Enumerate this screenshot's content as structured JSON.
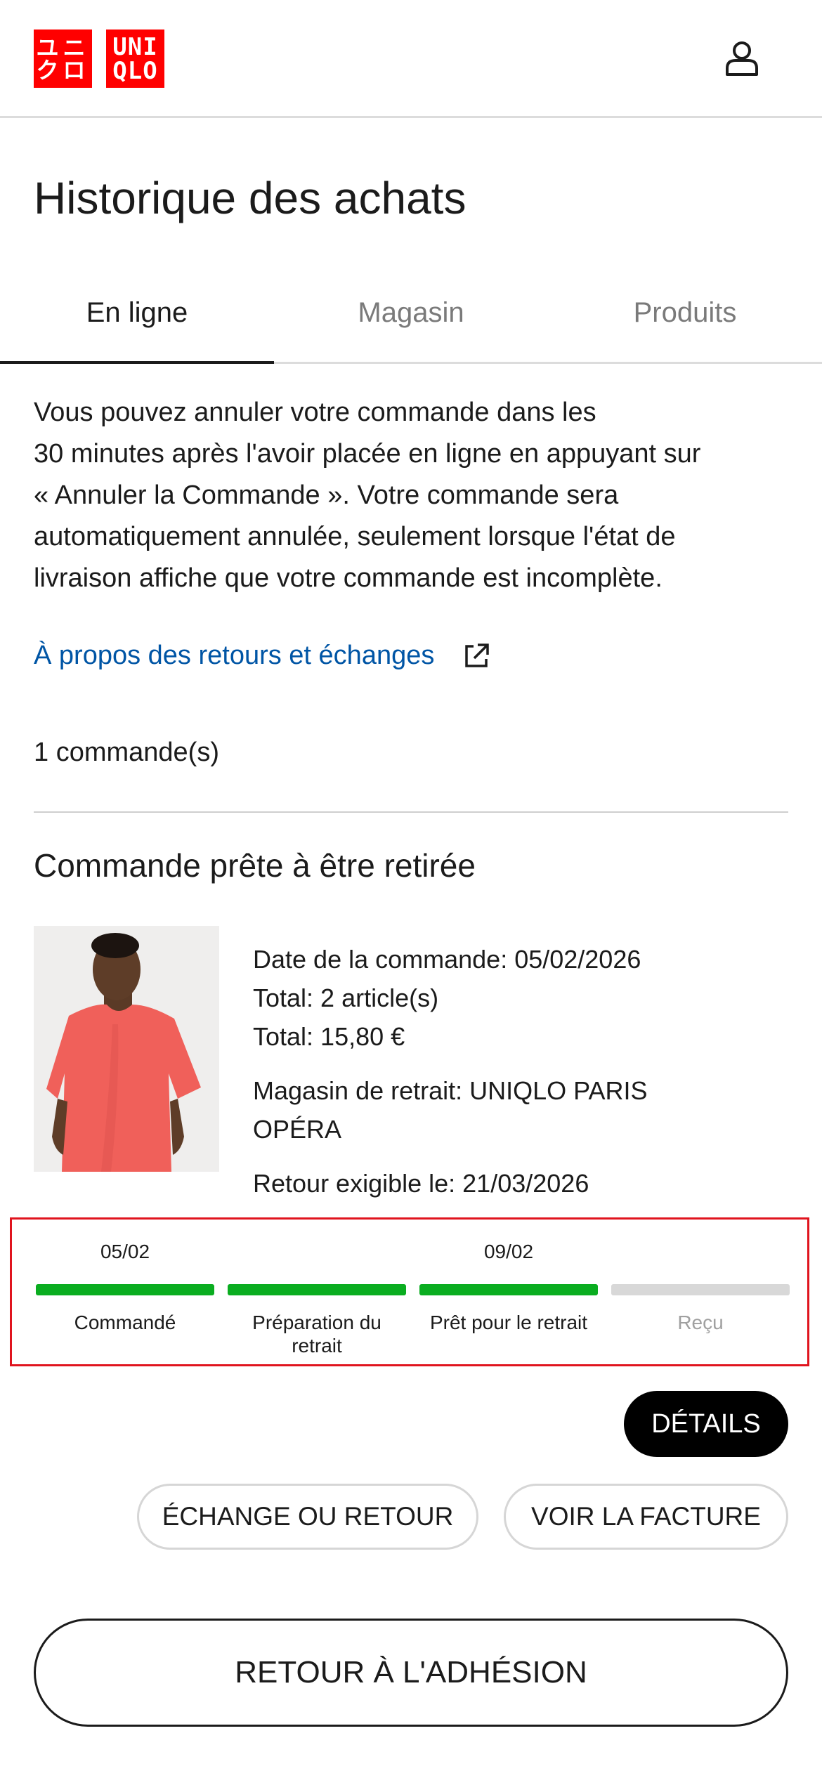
{
  "header": {
    "logo_jp_top": "ユニ",
    "logo_jp_bottom": "クロ",
    "logo_en_top": "UNI",
    "logo_en_bottom": "QLO",
    "account_icon": "user-icon"
  },
  "page": {
    "title": "Historique des achats"
  },
  "tabs": [
    {
      "label": "En ligne",
      "active": true
    },
    {
      "label": "Magasin",
      "active": false
    },
    {
      "label": "Produits",
      "active": false
    }
  ],
  "notice": {
    "line1": "Vous pouvez annuler votre commande dans les",
    "line2": "30 minutes après l'avoir placée en ligne en appuyant sur",
    "line3": "« Annuler la Commande ». Votre commande sera",
    "line4": "automatiquement annulée, seulement lorsque l'état de",
    "line5": "livraison affiche que votre commande est incomplète."
  },
  "returns_link": {
    "label": "À propos des retours et échanges",
    "icon": "external-link-icon"
  },
  "orders": {
    "count_label": "1 commande(s)"
  },
  "order": {
    "status": "Commande prête à être retirée",
    "date_line": "Date de la commande: 05/02/2026",
    "items_line": "Total: 2 article(s)",
    "total_line": "Total: 15,80 €",
    "store_line1": "Magasin de retrait: UNIQLO PARIS",
    "store_line2": "OPÉRA",
    "return_line": "Retour exigible le: 21/03/2026",
    "product_color": "#f0605a",
    "steps": [
      {
        "date": "05/02",
        "label_line1": "Commandé",
        "label_line2": "",
        "done": true
      },
      {
        "date": "",
        "label_line1": "Préparation du",
        "label_line2": "retrait",
        "done": true
      },
      {
        "date": "09/02",
        "label_line1": "Prêt pour le retrait",
        "label_line2": "",
        "done": true
      },
      {
        "date": "",
        "label_line1": "Reçu",
        "label_line2": "",
        "done": false
      }
    ],
    "done_color": "#0aad20",
    "pending_color": "#d8d8d8"
  },
  "buttons": {
    "details": "DÉTAILS",
    "exchange": "ÉCHANGE OU RETOUR",
    "invoice": "VOIR LA FACTURE",
    "membership": "RETOUR À L'ADHÉSION"
  },
  "colors": {
    "brand_red": "#ff0000",
    "link_blue": "#0055a5",
    "highlight_red": "#e0141e"
  }
}
